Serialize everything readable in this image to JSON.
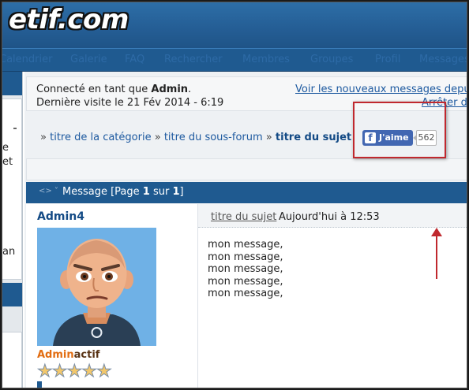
{
  "header": {
    "logo_text": "etif.com"
  },
  "nav": {
    "items": [
      "Calendrier",
      "Galerie",
      "FAQ",
      "Rechercher",
      "Membres",
      "Groupes",
      "Profil",
      "Messages"
    ]
  },
  "left_col": {
    "text1": "e",
    "text2": "et",
    "text3": "an"
  },
  "login": {
    "connected_prefix": "Connecté en tant que ",
    "username": "Admin",
    "connected_suffix": ".",
    "last_visit": "Dernière visite le 21 Fév 2014 - 6:19",
    "new_messages_link": "Voir les nouveaux messages depuis",
    "stop_link": "Arrêter de"
  },
  "breadcrumb": {
    "sep": "»",
    "category": "titre de la catégorie",
    "subforum": "titre du sous-forum",
    "topic": "titre du sujet"
  },
  "facebook": {
    "like_label": "J'aime",
    "count": "562"
  },
  "post_header": {
    "prefix": "Message [Page ",
    "page": "1",
    "middle": " sur ",
    "total": "1",
    "suffix": "]"
  },
  "author": {
    "name": "Admin4",
    "rank_a": "Admin",
    "rank_b": "actif",
    "stars": 5
  },
  "post": {
    "title_link": "titre du sujet",
    "date": "Aujourd'hui à 12:53",
    "lines": [
      "mon message,",
      "mon message,",
      "mon message,",
      "mon message,",
      "mon message,"
    ]
  },
  "colors": {
    "accent_blue": "#1f5a90",
    "link_blue": "#1e5aa0",
    "highlight_red": "#c0282e",
    "facebook_blue": "#4267b2",
    "rank_orange": "#e26d12"
  }
}
